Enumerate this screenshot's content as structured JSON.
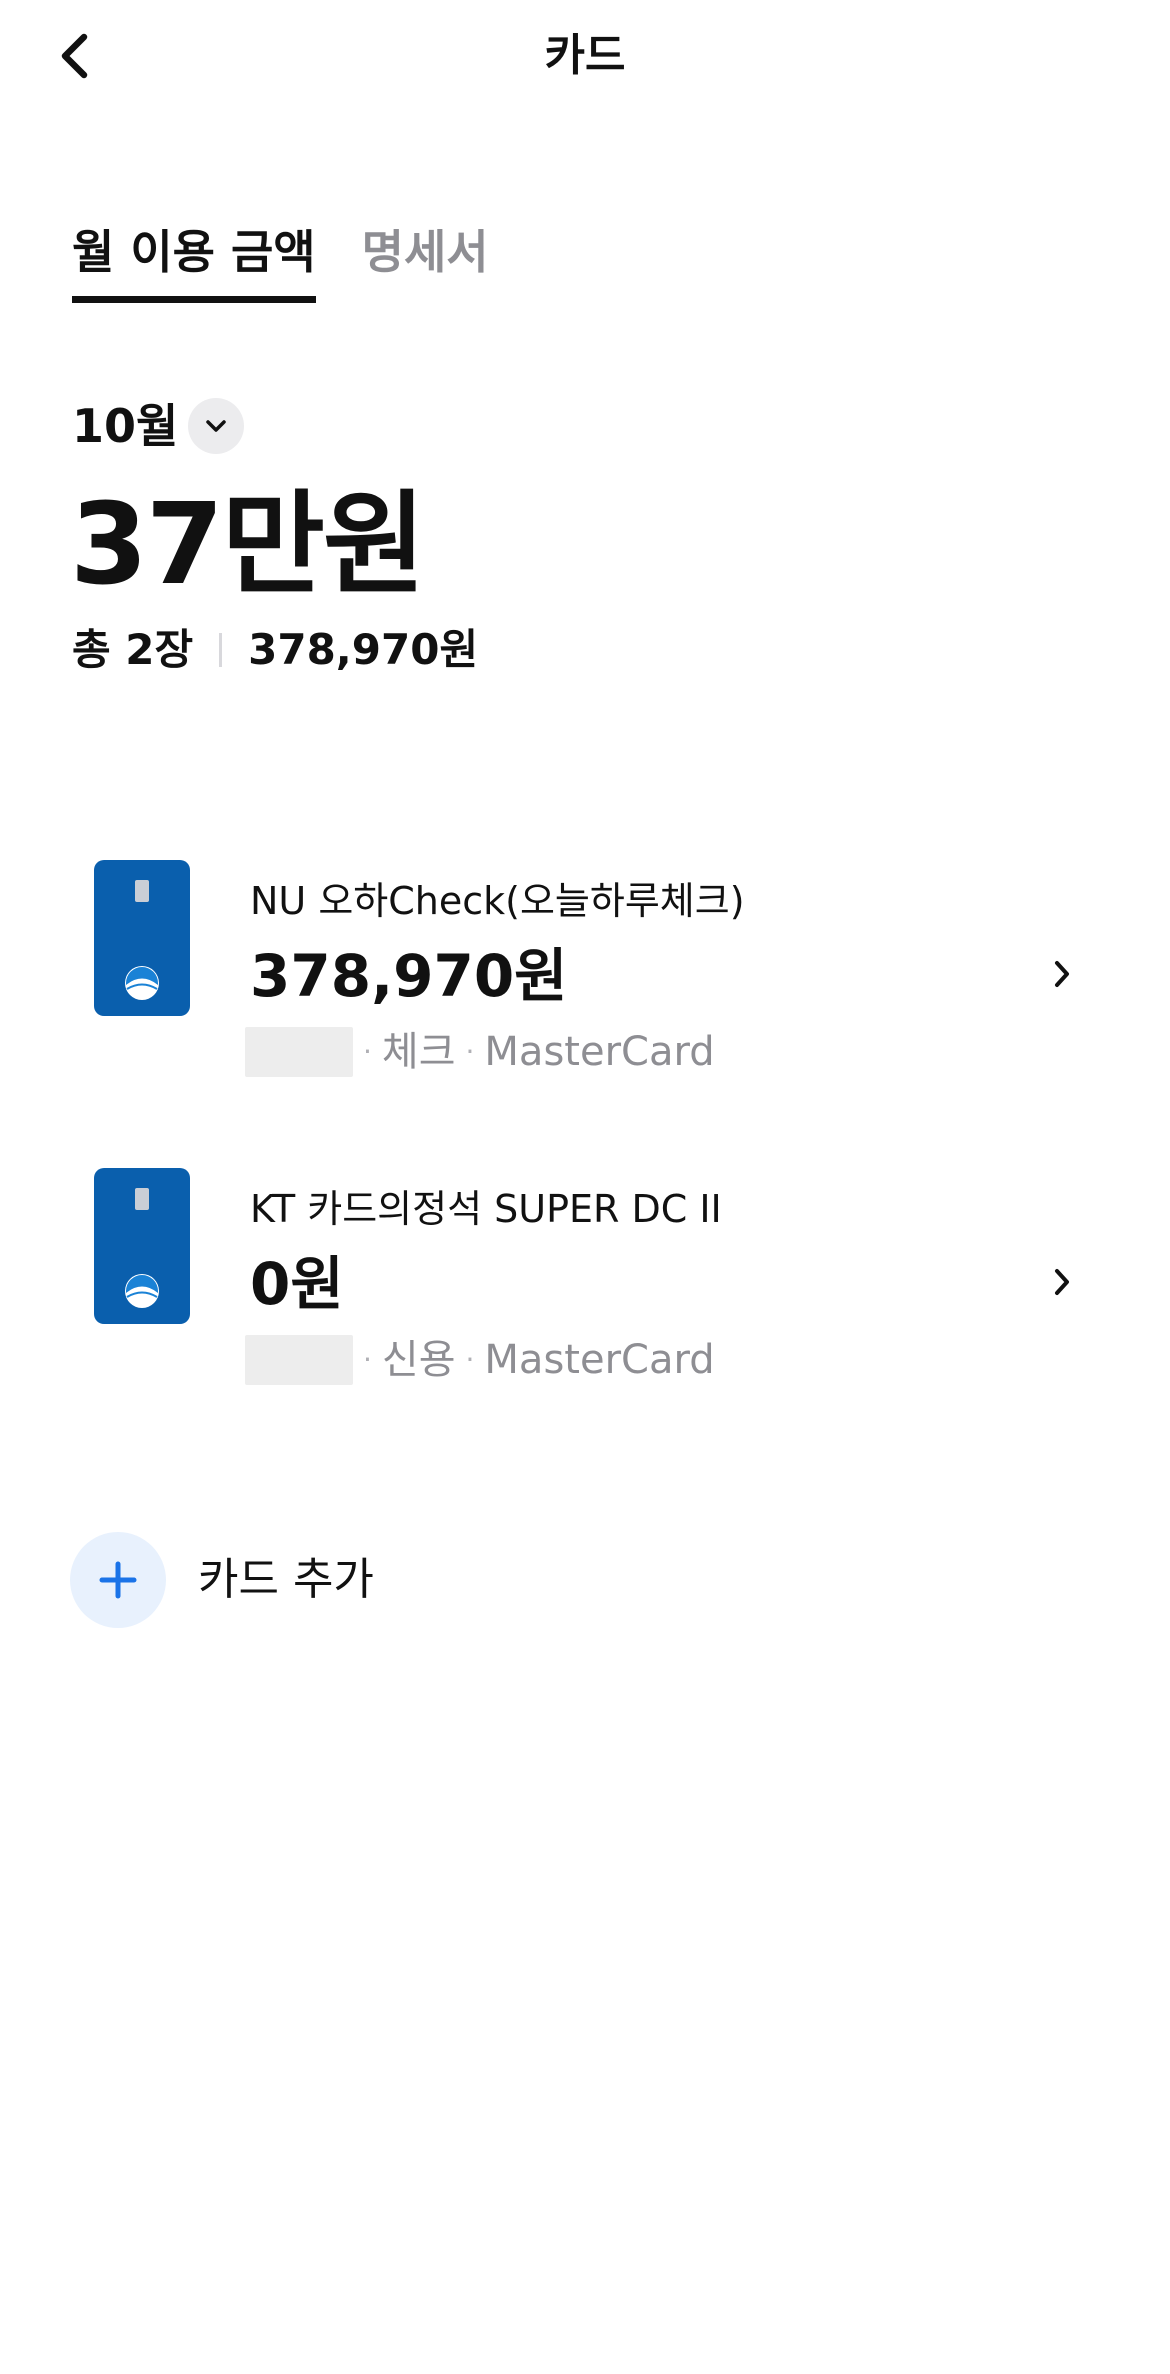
{
  "header": {
    "title": "카드",
    "back_icon": "chevron-left-icon"
  },
  "tabs": [
    {
      "label": "월 이용 금액",
      "active": true
    },
    {
      "label": "명세서",
      "active": false
    }
  ],
  "summary": {
    "month": "10월",
    "month_toggle_icon": "chevron-down-icon",
    "total_short": "37만원",
    "count_label": "총 2장",
    "total_amount": "378,970원"
  },
  "cards": [
    {
      "name": "NU 오하Check(오늘하루체크)",
      "amount": "378,970원",
      "type": "체크",
      "network": "MasterCard",
      "separator": "·",
      "card_color": "#0a5fad"
    },
    {
      "name": "KT 카드의정석 SUPER DC II",
      "amount": "0원",
      "type": "신용",
      "network": "MasterCard",
      "separator": "·",
      "card_color": "#0a5fad"
    }
  ],
  "add_card": {
    "label": "카드 추가",
    "icon": "plus-icon",
    "accent": "#1a73e8"
  }
}
